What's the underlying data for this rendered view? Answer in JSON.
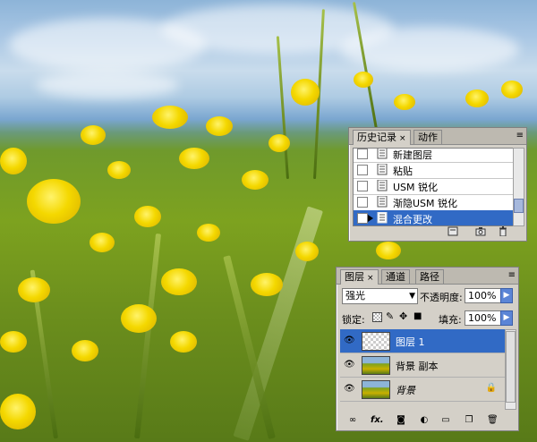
{
  "history_panel": {
    "tabs": [
      {
        "label": "历史记录",
        "close": "×"
      },
      {
        "label": "动作"
      }
    ],
    "menu_glyph": "≡",
    "items": [
      {
        "label": "新建图层"
      },
      {
        "label": "粘贴"
      },
      {
        "label": "USM 锐化"
      },
      {
        "label": "渐隐USM 锐化"
      },
      {
        "label": "混合更改",
        "selected": true
      }
    ],
    "bottom_icons": [
      "new-document-icon",
      "camera-icon",
      "trash-icon"
    ]
  },
  "layers_panel": {
    "tabs": [
      {
        "label": "图层",
        "close": "×"
      },
      {
        "label": "通道"
      },
      {
        "label": "路径"
      }
    ],
    "menu_glyph": "≡",
    "blend_mode": "强光",
    "opacity_label": "不透明度:",
    "opacity_value": "100%",
    "lock_label": "锁定:",
    "fill_label": "填充:",
    "fill_value": "100%",
    "layers": [
      {
        "name": "图层 1",
        "selected": true
      },
      {
        "name": "背景 副本"
      },
      {
        "name": "背景",
        "locked": true
      }
    ],
    "bottom_icons": [
      "link-icon",
      "fx-icon",
      "mask-icon",
      "adjustment-icon",
      "folder-icon",
      "new-layer-icon",
      "trash-icon"
    ],
    "fx_label": "fx."
  },
  "colors": {
    "selection": "#316ac5",
    "panel_bg": "#d4d0c8"
  }
}
